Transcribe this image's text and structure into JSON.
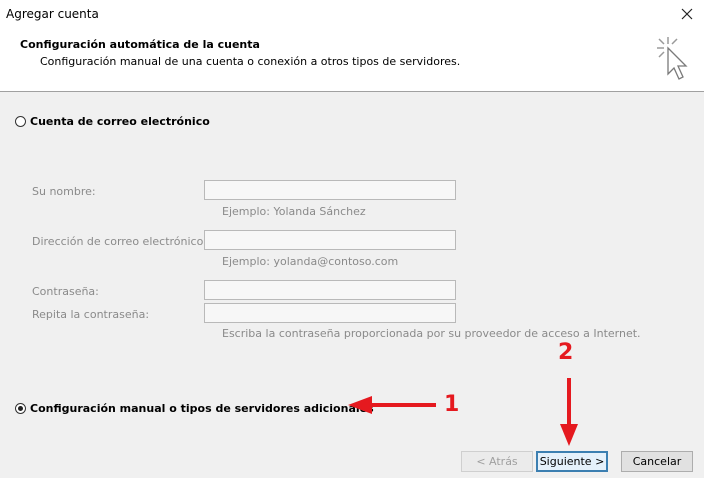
{
  "window": {
    "title": "Agregar cuenta",
    "close_icon": "close-icon"
  },
  "header": {
    "title": "Configuración automática de la cuenta",
    "subtitle": "Configuración manual de una cuenta o conexión a otros tipos de servidores.",
    "icon": "wizard-cursor-icon"
  },
  "options": {
    "email_account": {
      "label": "Cuenta de correo electrónico",
      "selected": false
    },
    "manual_setup": {
      "label": "Configuración manual o tipos de servidores adicionales",
      "selected": true
    }
  },
  "form": {
    "name": {
      "label": "Su nombre:",
      "value": "",
      "hint": "Ejemplo: Yolanda Sánchez"
    },
    "email": {
      "label": "Dirección de correo electrónico:",
      "value": "",
      "hint": "Ejemplo: yolanda@contoso.com"
    },
    "password": {
      "label": "Contraseña:",
      "value": ""
    },
    "repeat_password": {
      "label": "Repita la contraseña:",
      "value": ""
    },
    "password_hint": "Escriba la contraseña proporcionada por su proveedor de acceso a Internet."
  },
  "buttons": {
    "back": "< Atrás",
    "next": "Siguiente >",
    "cancel": "Cancelar"
  },
  "annotations": {
    "marker_1": "1",
    "marker_2": "2",
    "color": "#e5191f"
  }
}
